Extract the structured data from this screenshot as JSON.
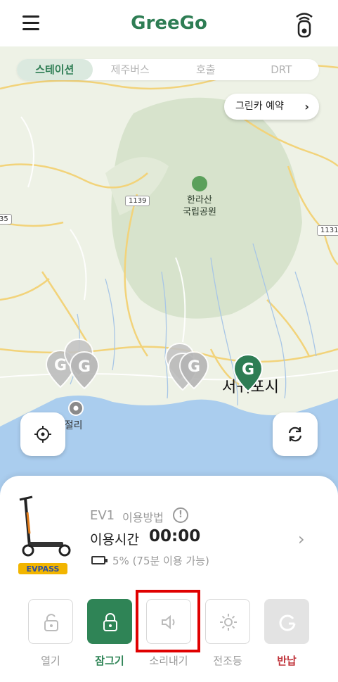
{
  "header": {
    "title": "GreeGo",
    "brand_color": "#2e7d54"
  },
  "tabs": [
    {
      "label": "스테이션",
      "active": true
    },
    {
      "label": "제주버스",
      "active": false
    },
    {
      "label": "호출",
      "active": false
    },
    {
      "label": "DRT",
      "active": false
    }
  ],
  "map": {
    "greencar_button": "그린카 예약",
    "road_labels": [
      "1139",
      "1131",
      "35"
    ],
    "park_name_line1": "한라산",
    "park_name_line2": "국립공원",
    "place_label": "주상절리",
    "city_label": "서귀포시",
    "marker_letter": "G"
  },
  "panel": {
    "vehicle_name": "EV1",
    "usage_link": "이용방법",
    "help_mark": "!",
    "time_label": "이용시간",
    "time_value": "00:00",
    "battery_percent": "5%",
    "battery_detail": "(75분 이용 가능)",
    "scooter_brand": "EVPASS"
  },
  "actions": [
    {
      "label": "열기",
      "icon": "unlock-icon",
      "state": "normal"
    },
    {
      "label": "잠그기",
      "icon": "lock-icon",
      "state": "active"
    },
    {
      "label": "소리내기",
      "icon": "speaker-icon",
      "state": "normal"
    },
    {
      "label": "전조등",
      "icon": "headlight-icon",
      "state": "normal"
    },
    {
      "label": "반납",
      "icon": "return-icon",
      "state": "disabled"
    }
  ],
  "colors": {
    "accent": "#2f8456",
    "danger": "#c0343b",
    "highlight": "#e00000",
    "sea": "#aacdee",
    "land": "#eef2e6",
    "park": "#d7e3cc"
  }
}
